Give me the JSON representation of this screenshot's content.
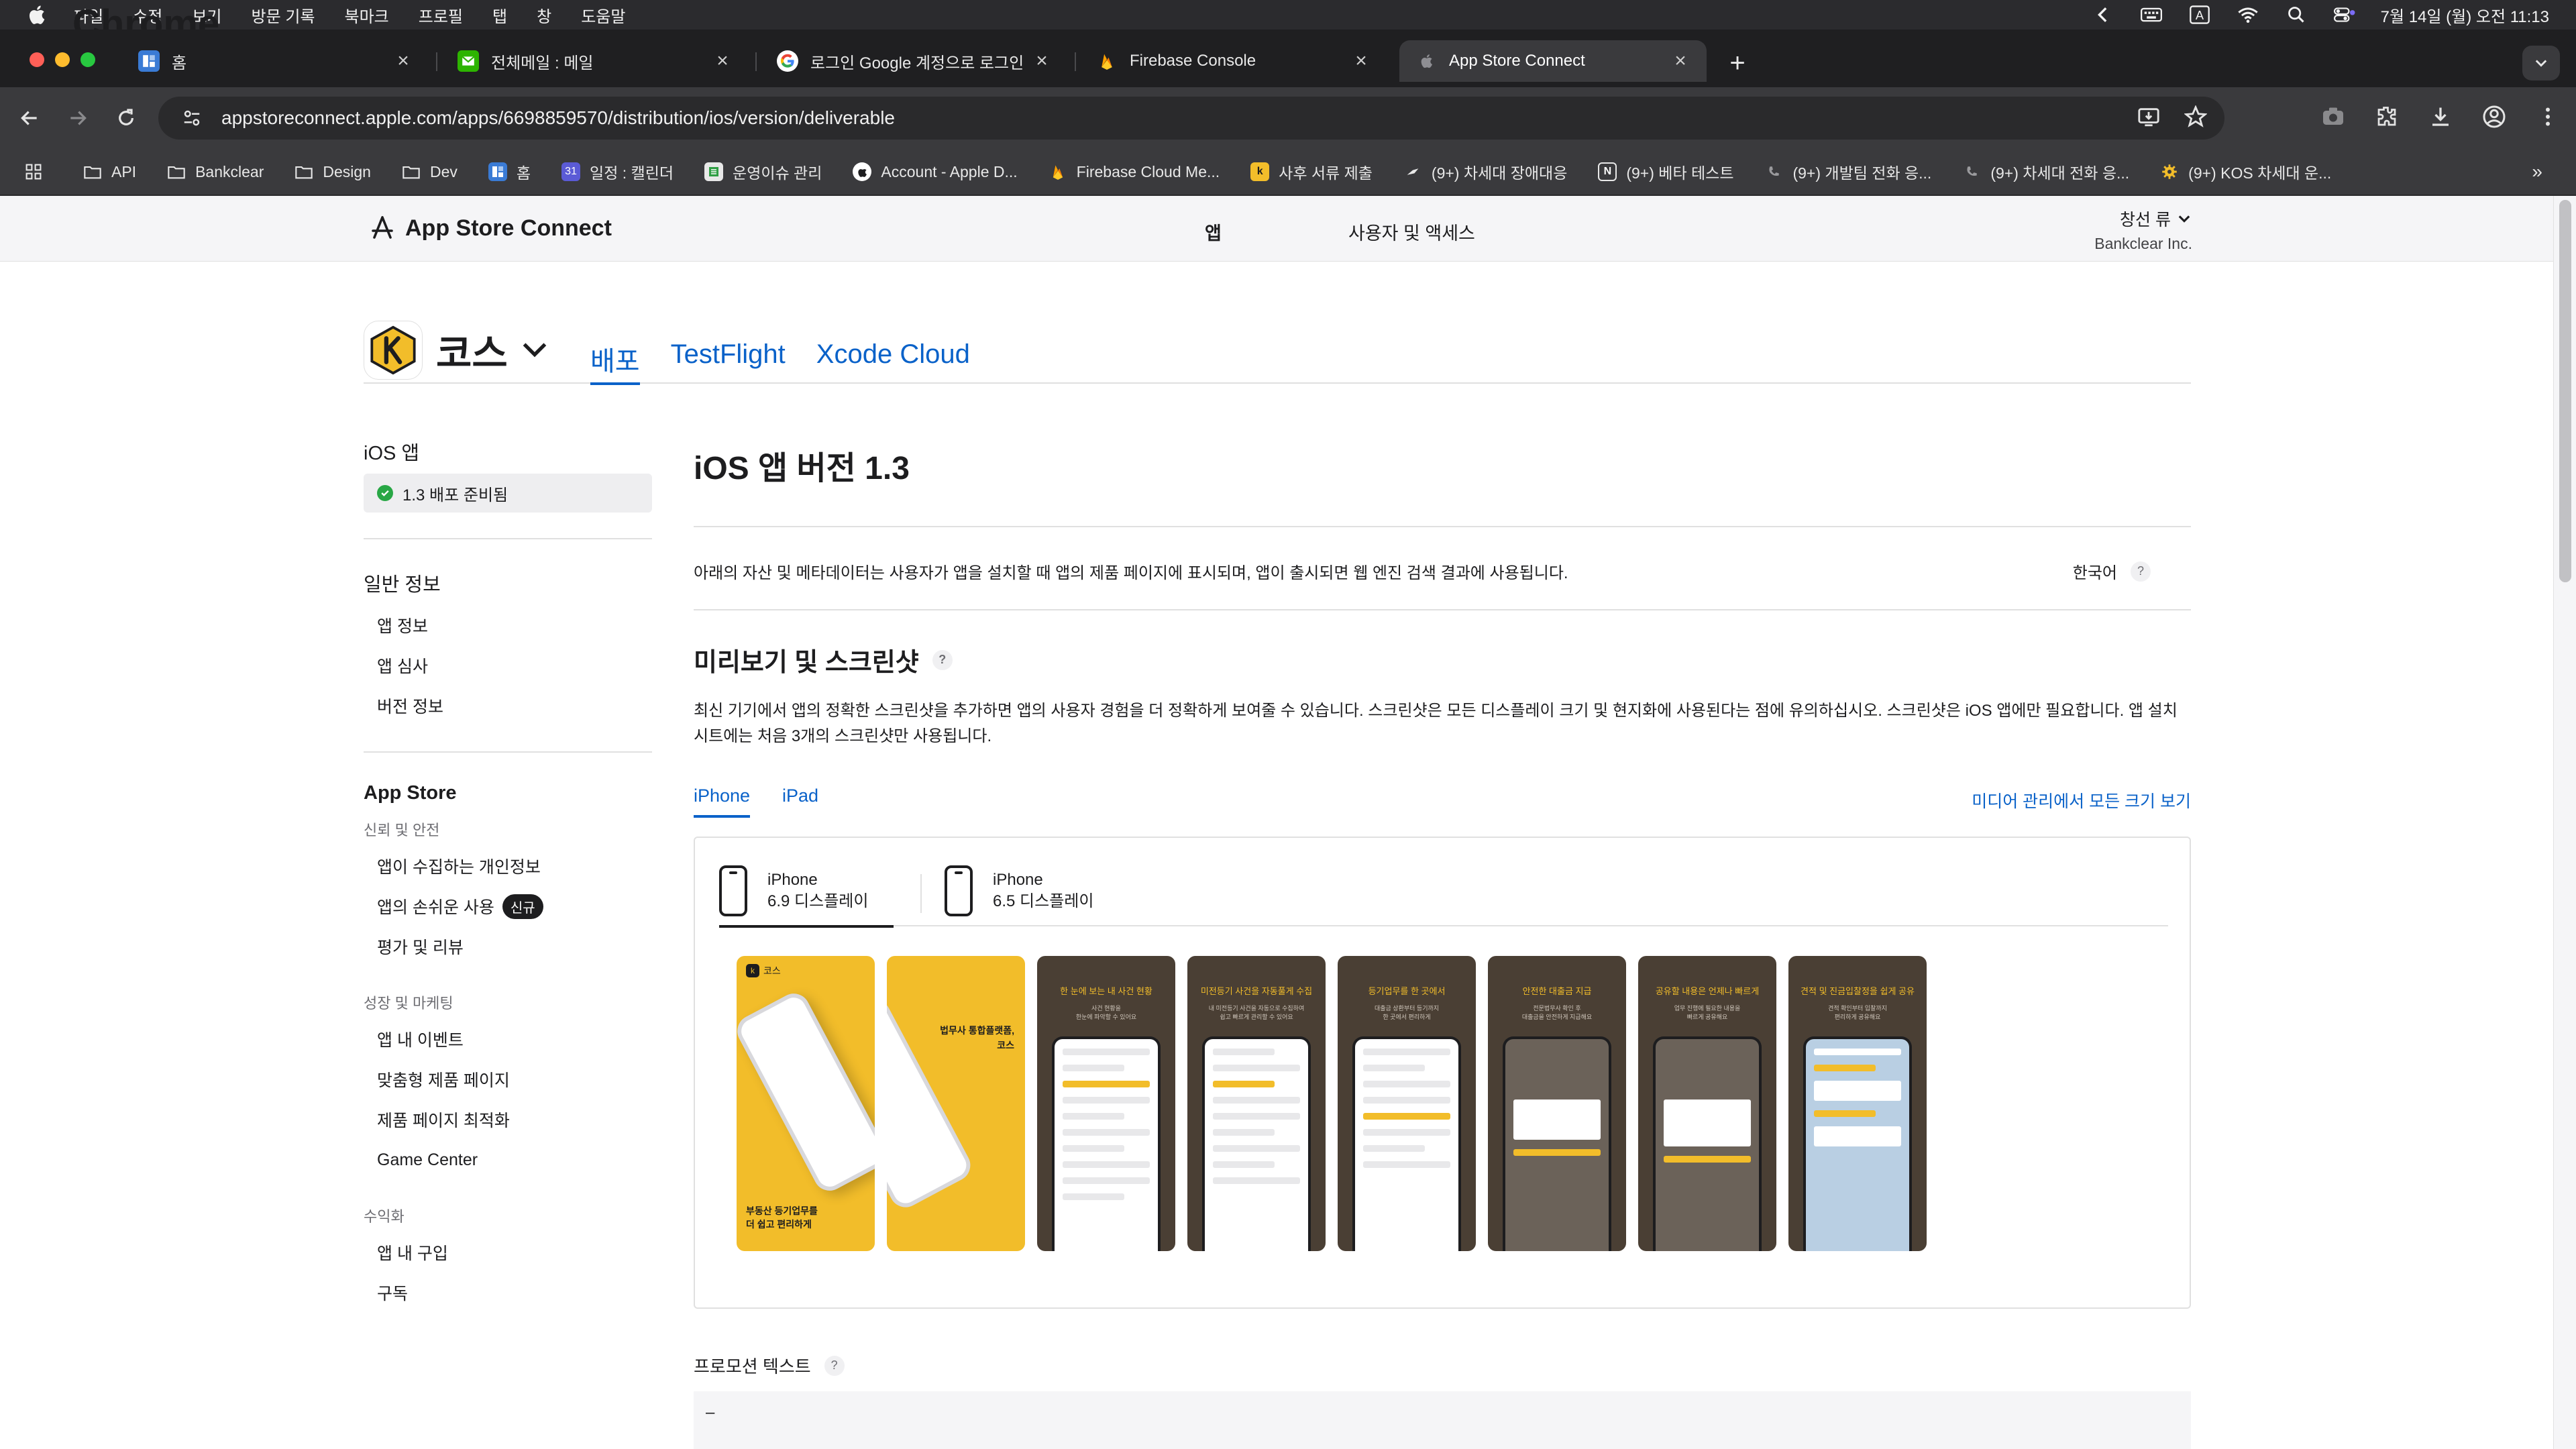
{
  "menubar": {
    "app_name": "Chrome",
    "items": [
      "파일",
      "수정",
      "보기",
      "방문 기록",
      "북마크",
      "프로필",
      "탭",
      "창",
      "도움말"
    ],
    "datetime": "7월 14일 (월) 오전 11:13",
    "input_indicator": "A"
  },
  "tabs": [
    {
      "title": "홈",
      "icon": "notion-like-icon",
      "color": "#3a7bd5"
    },
    {
      "title": "전체메일 : 메일",
      "icon": "mail-icon",
      "color": "#2db400"
    },
    {
      "title": "로그인 Google 계정으로 로그인합니다",
      "icon": "google-icon",
      "color": "#ffffff"
    },
    {
      "title": "Firebase Console",
      "icon": "firebase-icon",
      "color": "#ff9100"
    },
    {
      "title": "App Store Connect",
      "icon": "apple-icon",
      "color": "#8e8e93"
    }
  ],
  "omnibox": {
    "url": "appstoreconnect.apple.com/apps/6698859570/distribution/ios/version/deliverable"
  },
  "bookmarks": [
    {
      "label": "API",
      "icon": "folder-icon"
    },
    {
      "label": "Bankclear",
      "icon": "folder-icon"
    },
    {
      "label": "Design",
      "icon": "folder-icon"
    },
    {
      "label": "Dev",
      "icon": "folder-icon"
    },
    {
      "label": "홈",
      "icon": "notion-like-icon"
    },
    {
      "label": "일정 : 캘린더",
      "icon": "calendar-icon"
    },
    {
      "label": "운영이슈 관리",
      "icon": "sheet-icon"
    },
    {
      "label": "Account - Apple D...",
      "icon": "apple-dev-icon"
    },
    {
      "label": "Firebase Cloud Me...",
      "icon": "firebase-icon"
    },
    {
      "label": "사후 서류 제출",
      "icon": "kos-icon"
    },
    {
      "label": "(9+) 차세대 장애대응",
      "icon": "slack-like-icon"
    },
    {
      "label": "(9+) 베타 테스트",
      "icon": "notion-icon"
    },
    {
      "label": "(9+) 개발팀 전화 응...",
      "icon": "phone-icon"
    },
    {
      "label": "(9+) 차세대 전화 응...",
      "icon": "phone-icon"
    },
    {
      "label": "(9+) KOS 차세대 운...",
      "icon": "gear-yellow-icon"
    }
  ],
  "asc": {
    "logo_text": "App Store Connect",
    "nav_apps": "앱",
    "nav_users": "사용자 및 액세스",
    "user_name": "창선 류",
    "org_name": "Bankclear Inc."
  },
  "app": {
    "name": "코스",
    "tabs": [
      "배포",
      "TestFlight",
      "Xcode Cloud"
    ],
    "active_tab": "배포"
  },
  "sidebar": {
    "ios_section": "iOS 앱",
    "selected_version": "1.3 배포 준비됨",
    "general_section": "일반 정보",
    "general_items": [
      "앱 정보",
      "앱 심사",
      "버전 정보"
    ],
    "appstore_section": "App Store",
    "trust_sub": "신뢰 및 안전",
    "trust_items": [
      "앱이 수집하는 개인정보",
      "앱의 손쉬운 사용",
      "평가 및 리뷰"
    ],
    "new_badge": "신규",
    "growth_sub": "성장 및 마케팅",
    "growth_items": [
      "앱 내 이벤트",
      "맞춤형 제품 페이지",
      "제품 페이지 최적화",
      "Game Center"
    ],
    "revenue_sub": "수익화",
    "revenue_items": [
      "앱 내 구입",
      "구독"
    ]
  },
  "main": {
    "title": "iOS 앱 버전 1.3",
    "description": "아래의 자산 및 메타데이터는 사용자가 앱을 설치할 때 앱의 제품 페이지에 표시되며, 앱이 출시되면 웹 엔진 검색 결과에 사용됩니다.",
    "language": "한국어",
    "preview_title": "미리보기 및 스크린샷",
    "preview_desc": "최신 기기에서 앱의 정확한 스크린샷을 추가하면 앱의 사용자 경험을 더 정확하게 보여줄 수 있습니다. 스크린샷은 모든 디스플레이 크기 및 현지화에 사용된다는 점에 유의하십시오. 스크린샷은 iOS 앱에만 필요합니다. 앱 설치 시트에는 처음 3개의 스크린샷만 사용됩니다.",
    "device_tabs": [
      "iPhone",
      "iPad"
    ],
    "media_link": "미디어 관리에서 모든 크기 보기",
    "displays": [
      {
        "line1": "iPhone",
        "line2": "6.9 디스플레이"
      },
      {
        "line1": "iPhone",
        "line2": "6.5 디스플레이"
      }
    ],
    "screenshots": [
      {
        "logo": "코스",
        "text": "부동산 등기업무를\n더 쉽고 편리하게"
      },
      {
        "text": "법무사 통합플랫폼,\n코스"
      },
      {
        "caption": "한 눈에 보는 내 사건 현황",
        "sub": "사건 현황을\n한눈에 파악할 수 있어요"
      },
      {
        "caption": "미전등기 사건을 자동풀게 수집",
        "sub": "내 미전등기 사건을 자동으로 수집하여\n쉽고 빠르게 관리할 수 있어요"
      },
      {
        "caption": "등기업무를 한 곳에서",
        "sub": "대출금 상환부터 등기까지\n한 곳에서 편리하게"
      },
      {
        "caption": "안전한 대출금 지급",
        "sub": "전문법무사 확인 후\n대출금을 안전하게 지급해요"
      },
      {
        "caption": "공유할 내용은 언제나 빠르게",
        "sub": "업무 진행에 필요한 내용을\n빠르게 공유해요"
      },
      {
        "caption": "견적 및 진금입찰정을 쉽게 공유",
        "sub": "견적 확인부터 입찰까지\n편리하게 공유해요"
      }
    ],
    "promo_title": "프로모션 텍스트",
    "promo_value": "–"
  },
  "colors": {
    "accent": "#0a62c9",
    "brand_yellow": "#f2bd2a",
    "status_green": "#28a745"
  }
}
